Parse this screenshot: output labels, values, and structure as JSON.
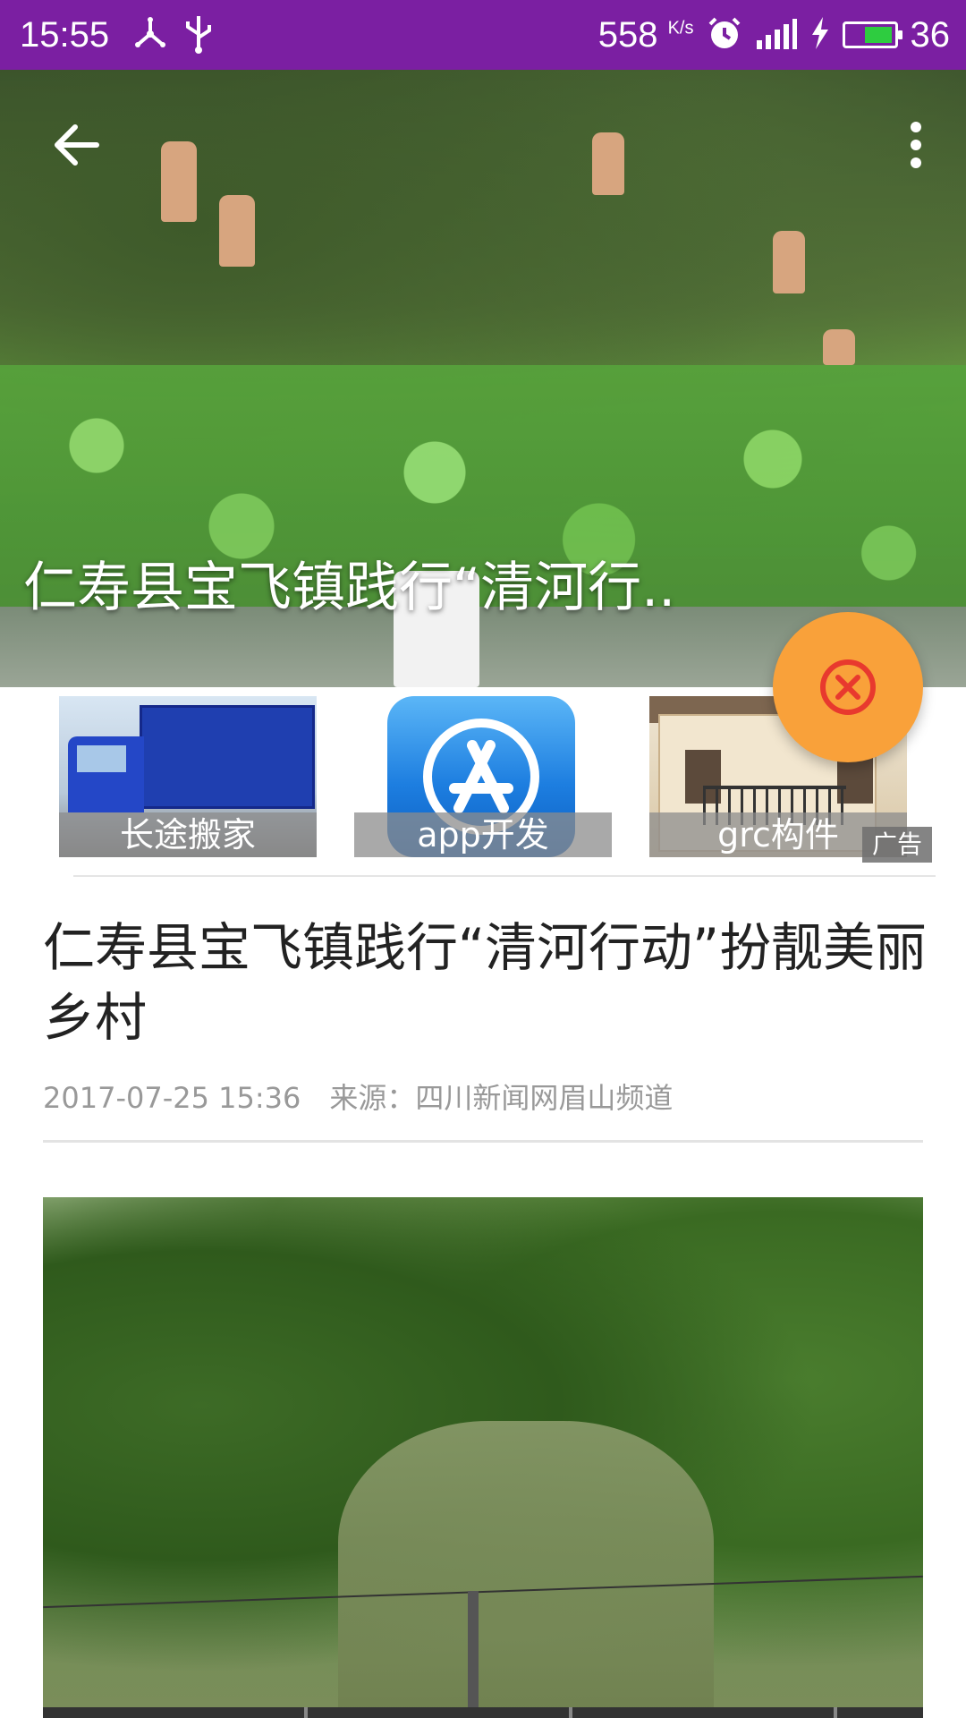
{
  "status_bar": {
    "time": "15:55",
    "speed": "558",
    "speed_unit": "K/s",
    "battery_level": "36",
    "icons": [
      "usb-tether-icon",
      "usb-icon",
      "alarm-icon",
      "signal-4g-icon",
      "charging-icon",
      "battery-icon"
    ],
    "background_color": "#7b1fa2"
  },
  "hero": {
    "caption": "仁寿县宝飞镇践行“清河行..",
    "back_icon": "arrow-left-icon",
    "more_icon": "more-vertical-icon"
  },
  "fab": {
    "icon": "close-circle-icon",
    "color": "#f9a13a"
  },
  "ads": {
    "items": [
      {
        "label": "长途搬家"
      },
      {
        "label": "app开发"
      },
      {
        "label": "grc构件"
      }
    ],
    "tag": "广告"
  },
  "article": {
    "title": "仁寿县宝飞镇践行“清河行动”扮靓美丽乡村",
    "date": "2017-07-25 15:36",
    "source": "来源：四川新闻网眉山频道"
  }
}
